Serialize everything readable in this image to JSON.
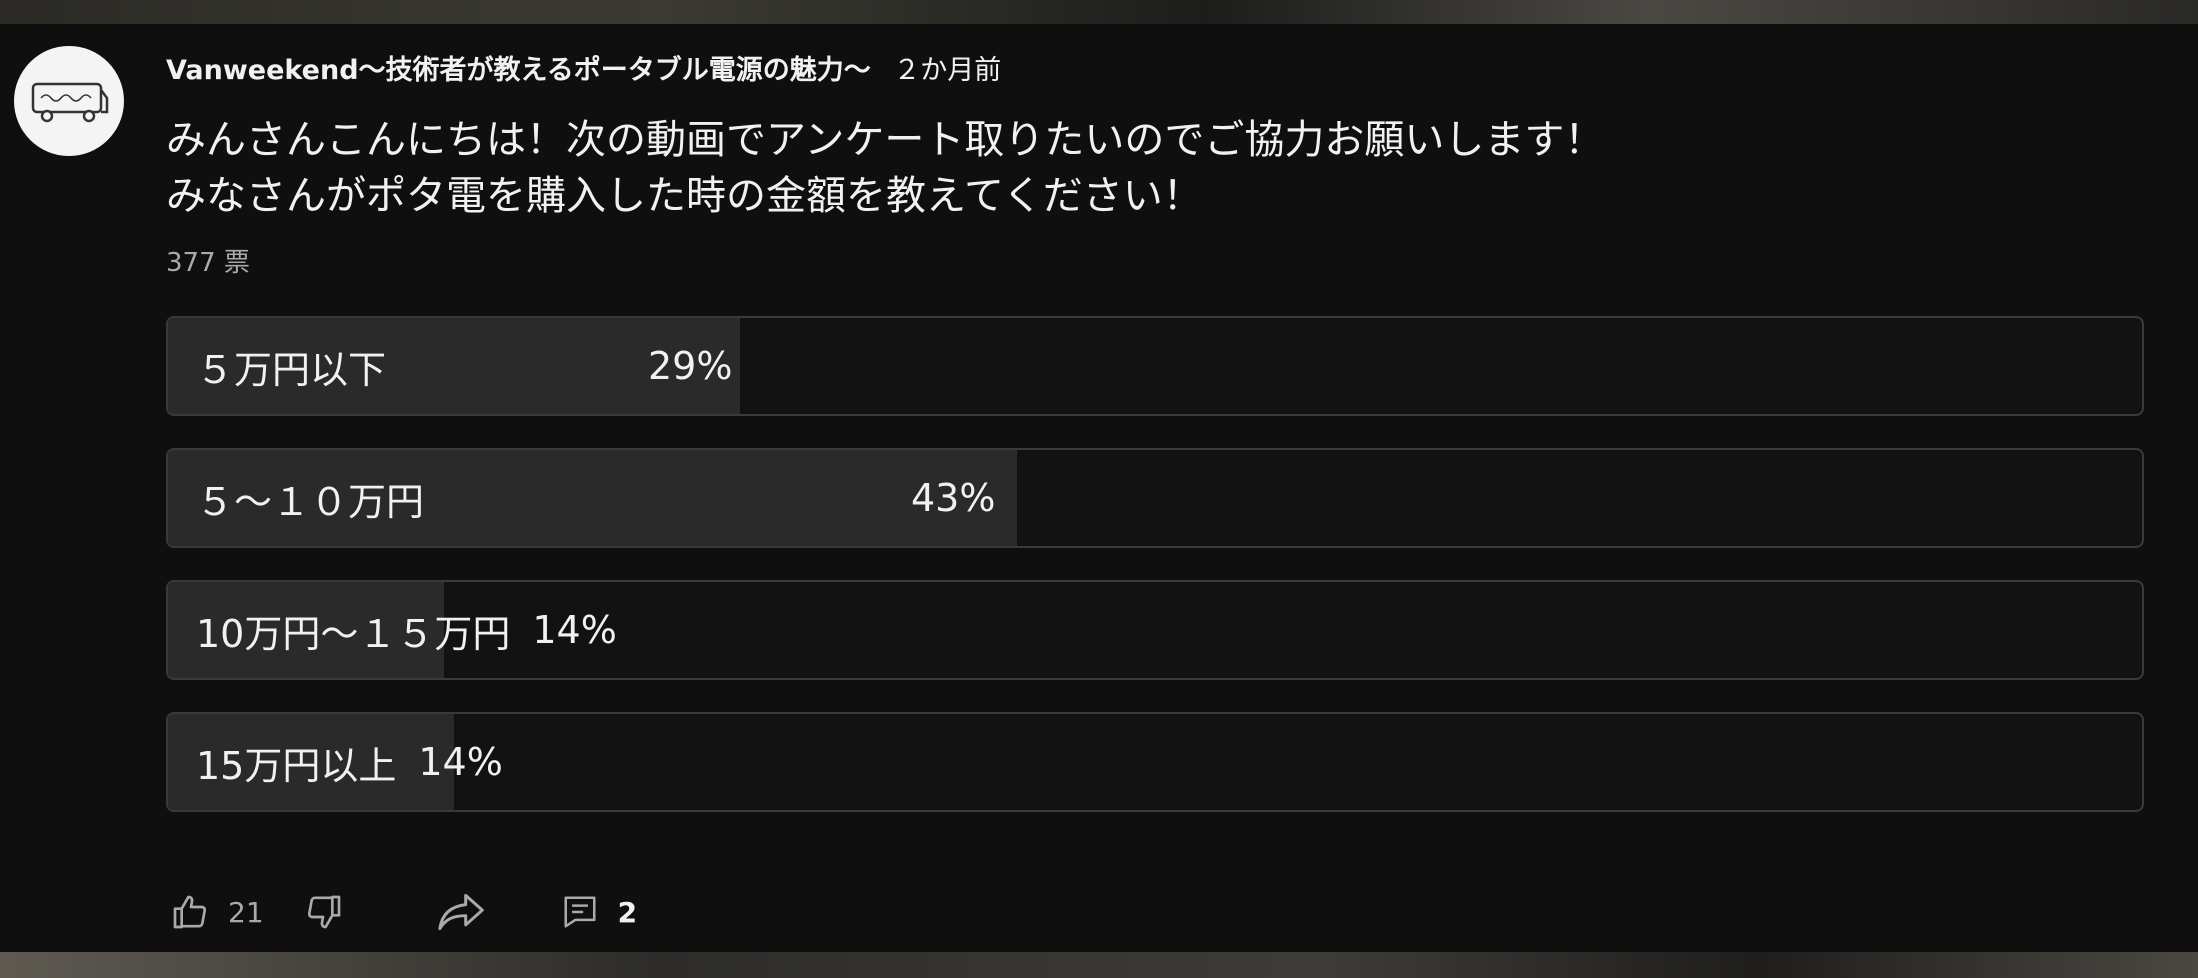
{
  "post": {
    "author": "Vanweekend〜技術者が教えるポータブル電源の魅力〜",
    "time": "２か月前",
    "text_line1": "みんさんこんにちは！次の動画でアンケート取りたいのでご協力お願いします！",
    "text_line2": "みなさんがポタ電を購入した時の金額を教えてください！",
    "avatar_text": "Vanweekend"
  },
  "poll": {
    "votes": "377 票",
    "options": [
      {
        "label": "５万円以下",
        "percent": "29%",
        "fraction": 0.29
      },
      {
        "label": "５〜１０万円",
        "percent": "43%",
        "fraction": 0.43
      },
      {
        "label": "10万円〜１５万円",
        "percent": "14%",
        "fraction": 0.14
      },
      {
        "label": "15万円以上",
        "percent": "14%",
        "fraction": 0.14
      }
    ]
  },
  "actions": {
    "like_count": "21",
    "reply_count": "2"
  },
  "colors": {
    "background": "#0f0f0f",
    "bar_fill": "#2a2a2a",
    "border": "#3a3a3a",
    "text": "#f1f1f1",
    "muted": "#aaaaaa"
  },
  "icons": [
    "thumb-up-icon",
    "thumb-down-icon",
    "share-icon",
    "comment-icon"
  ]
}
